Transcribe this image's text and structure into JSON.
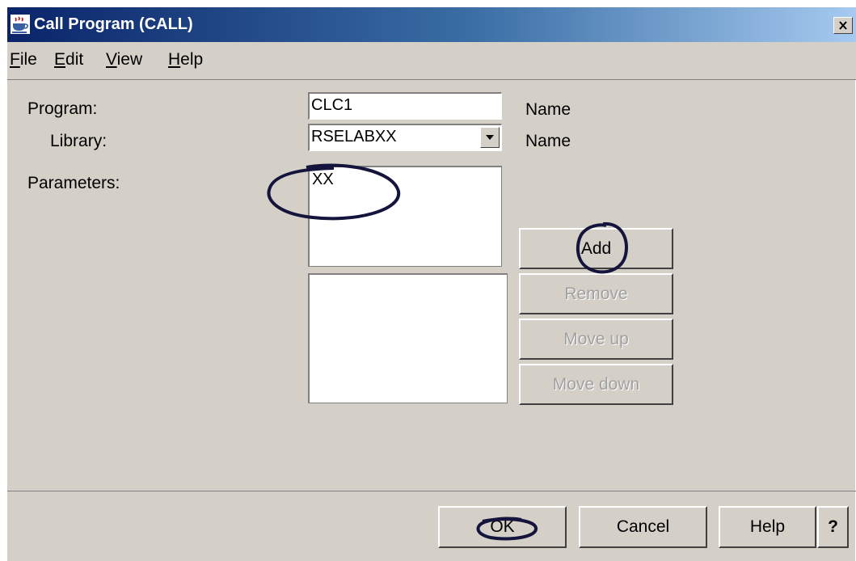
{
  "window": {
    "title": "Call Program (CALL)",
    "close_label": "x",
    "app_icon": "java-cup-icon"
  },
  "menu": [
    {
      "label": "File",
      "mnemonic": "F"
    },
    {
      "label": "Edit",
      "mnemonic": "E"
    },
    {
      "label": "View",
      "mnemonic": "V"
    },
    {
      "label": "Help",
      "mnemonic": "H"
    }
  ],
  "form": {
    "program_label": "Program:",
    "program_value": "CLC1",
    "program_hint": "Name",
    "library_label": "Library:",
    "library_value": "RSELABXX",
    "library_hint": "Name",
    "parameters_label": "Parameters:",
    "parameter_entry": "XX",
    "parameter_list": []
  },
  "param_buttons": {
    "add": "Add",
    "remove": "Remove",
    "move_up": "Move up",
    "move_down": "Move down"
  },
  "footer": {
    "ok": "OK",
    "cancel": "Cancel",
    "help": "Help",
    "context_help": "?"
  },
  "colors": {
    "dialog_bg": "#d4d0c8",
    "title_start": "#0a246a",
    "title_end": "#a6caf0",
    "annotation": "#14143c"
  },
  "annotations": [
    "circle-parameter-entry",
    "circle-add-button",
    "circle-ok-button"
  ]
}
